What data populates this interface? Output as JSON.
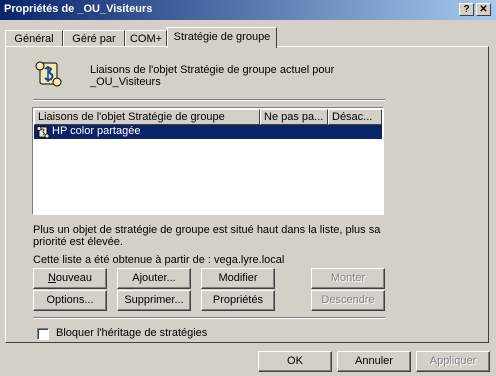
{
  "window": {
    "title": "Propriétés de _OU_Visiteurs",
    "help_btn": "?",
    "close_btn": "✕"
  },
  "tabs": [
    {
      "label": "Général"
    },
    {
      "label": "Géré par"
    },
    {
      "label": "COM+"
    },
    {
      "label": "Stratégie de groupe"
    }
  ],
  "header": {
    "icon": "gpo-scroll-icon",
    "line1": "Liaisons de l'objet Stratégie de groupe actuel pour",
    "line2": "_OU_Visiteurs"
  },
  "list": {
    "columns": [
      "Liaisons de l'objet Stratégie de groupe",
      "Ne pas pa...",
      "Désac..."
    ],
    "rows": [
      {
        "name": "HP color partagée",
        "icon": "gpo-scroll-icon",
        "selected": true
      }
    ]
  },
  "info": {
    "priority_line1": "Plus un objet de stratégie de groupe est situé haut dans la liste, plus sa",
    "priority_line2": "priorité est élevée.",
    "source": "Cette liste a été obtenue à partir de : vega.lyre.local"
  },
  "buttons": {
    "new": "Nouveau",
    "add": "Ajouter...",
    "modify": "Modifier",
    "move_up": "Monter",
    "options": "Options...",
    "delete": "Supprimer...",
    "properties": "Propriétés",
    "move_down": "Descendre"
  },
  "block_inheritance": {
    "label": "Bloquer l'héritage de stratégies",
    "checked": false
  },
  "footer": {
    "ok": "OK",
    "cancel": "Annuler",
    "apply": "Appliquer"
  }
}
